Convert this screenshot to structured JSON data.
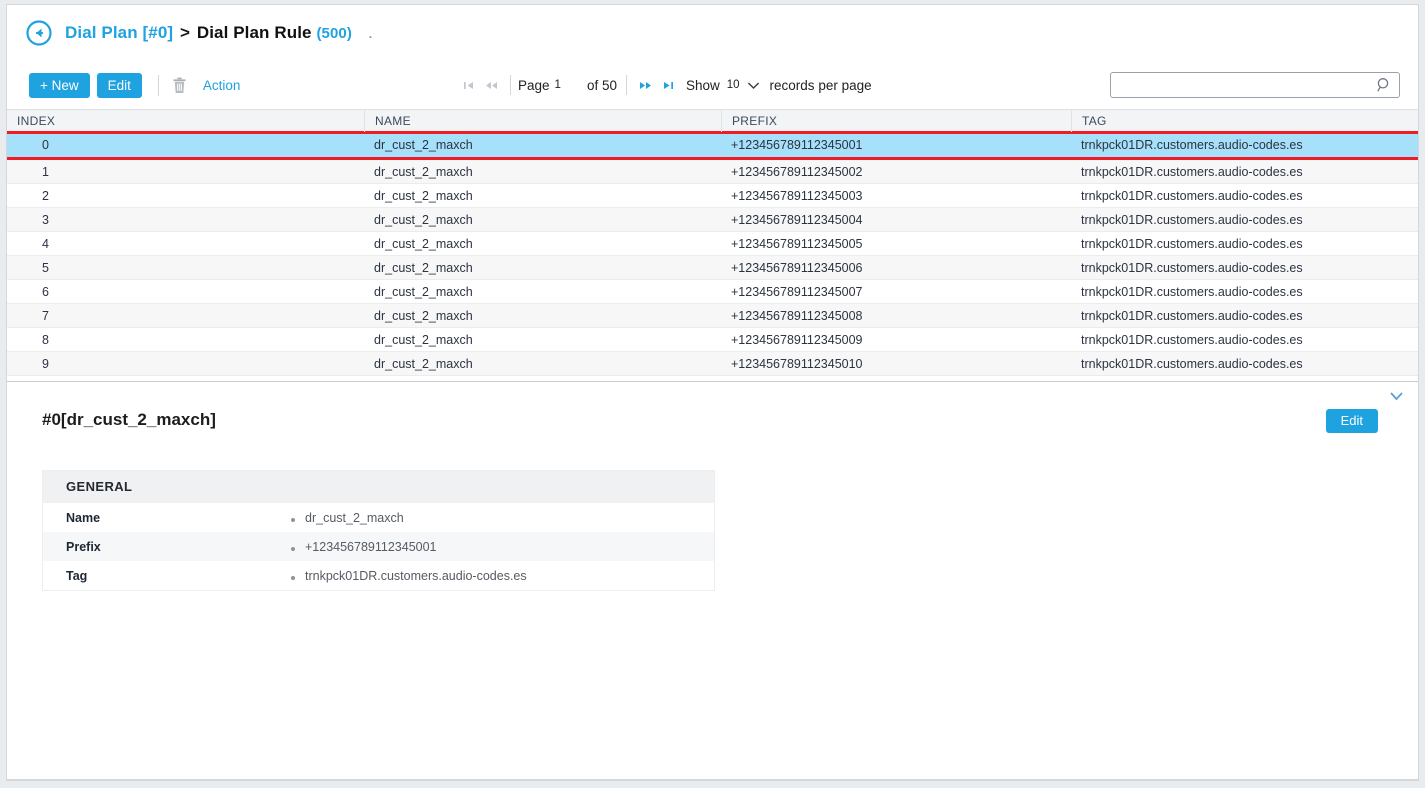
{
  "breadcrumb": {
    "back_icon": "circle-back-arrow-icon",
    "parent": "Dial Plan [#0]",
    "separator": ">",
    "current": "Dial Plan Rule",
    "count": "(500)",
    "trailing_dot": "."
  },
  "toolbar": {
    "new_label": "+ New",
    "edit_label": "Edit",
    "delete_icon": "trash-icon",
    "action_label": "Action"
  },
  "pagination": {
    "first_icon": "first-page-icon",
    "prev_icon": "prev-page-icon",
    "page_label": "Page",
    "page_number": "1",
    "of_label": "of 50",
    "next_icon": "next-page-icon",
    "last_icon": "last-page-icon",
    "show_label": "Show",
    "page_size": "10",
    "chevron_icon": "chevron-down-icon",
    "records_label": "records per page"
  },
  "search": {
    "value": "",
    "placeholder": "",
    "icon": "search-icon"
  },
  "table": {
    "columns": [
      "INDEX",
      "NAME",
      "PREFIX",
      "TAG"
    ],
    "selected_index": 0,
    "rows": [
      {
        "index": "0",
        "name": "dr_cust_2_maxch",
        "prefix": "+123456789112345001",
        "tag": "trnkpck01DR.customers.audio-codes.es"
      },
      {
        "index": "1",
        "name": "dr_cust_2_maxch",
        "prefix": "+123456789112345002",
        "tag": "trnkpck01DR.customers.audio-codes.es"
      },
      {
        "index": "2",
        "name": "dr_cust_2_maxch",
        "prefix": "+123456789112345003",
        "tag": "trnkpck01DR.customers.audio-codes.es"
      },
      {
        "index": "3",
        "name": "dr_cust_2_maxch",
        "prefix": "+123456789112345004",
        "tag": "trnkpck01DR.customers.audio-codes.es"
      },
      {
        "index": "4",
        "name": "dr_cust_2_maxch",
        "prefix": "+123456789112345005",
        "tag": "trnkpck01DR.customers.audio-codes.es"
      },
      {
        "index": "5",
        "name": "dr_cust_2_maxch",
        "prefix": "+123456789112345006",
        "tag": "trnkpck01DR.customers.audio-codes.es"
      },
      {
        "index": "6",
        "name": "dr_cust_2_maxch",
        "prefix": "+123456789112345007",
        "tag": "trnkpck01DR.customers.audio-codes.es"
      },
      {
        "index": "7",
        "name": "dr_cust_2_maxch",
        "prefix": "+123456789112345008",
        "tag": "trnkpck01DR.customers.audio-codes.es"
      },
      {
        "index": "8",
        "name": "dr_cust_2_maxch",
        "prefix": "+123456789112345009",
        "tag": "trnkpck01DR.customers.audio-codes.es"
      },
      {
        "index": "9",
        "name": "dr_cust_2_maxch",
        "prefix": "+123456789112345010",
        "tag": "trnkpck01DR.customers.audio-codes.es"
      }
    ]
  },
  "detail": {
    "title": "#0[dr_cust_2_maxch]",
    "edit_label": "Edit",
    "collapse_icon": "chevron-down-icon",
    "card": {
      "header": "GENERAL",
      "fields": [
        {
          "key": "Name",
          "value": "dr_cust_2_maxch"
        },
        {
          "key": "Prefix",
          "value": "+123456789112345001"
        },
        {
          "key": "Tag",
          "value": "trnkpck01DR.customers.audio-codes.es"
        }
      ]
    }
  },
  "colors": {
    "accent": "#1fa2e0",
    "selection_row": "#a6e0fa",
    "selection_outline": "#f01c25",
    "header_bg": "#f3f4f6",
    "alt_row": "#f7f7f8"
  }
}
